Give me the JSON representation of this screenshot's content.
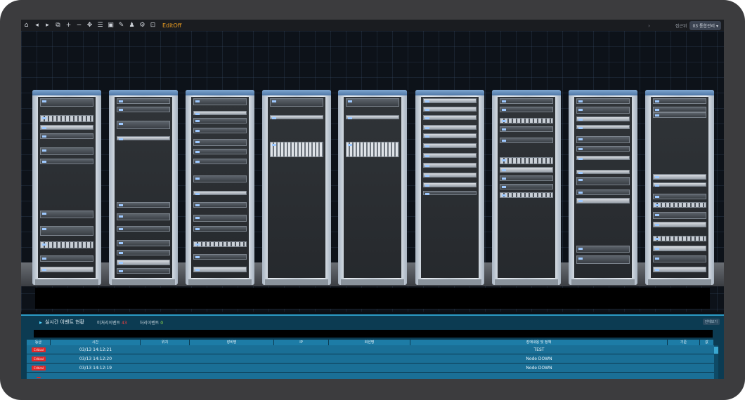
{
  "toolbar": {
    "icons": [
      "home-icon",
      "step-back-icon",
      "play-icon",
      "copy-icon",
      "add-icon",
      "remove-icon",
      "move-icon",
      "grid-icon",
      "image-icon",
      "user-add-icon",
      "user-icon",
      "user-settings-icon",
      "export-icon"
    ],
    "glyphs": [
      "⌂",
      "◂",
      "▸",
      "⧉",
      "+",
      "−",
      "✥",
      "☰",
      "▣",
      "✎",
      "♟",
      "⚙",
      "⊡"
    ],
    "edit_label": "EditOff",
    "layout_label": "접근위",
    "layout_value": "03 통합관리 ▾"
  },
  "event_panel": {
    "title": "실시간 이벤트 현황",
    "unresolved_label": "미처리이벤트",
    "unresolved_count": "43",
    "resolved_label": "처리이벤트",
    "resolved_count": "0",
    "button_label": "전체보기",
    "columns": [
      "등급",
      "시간",
      "위치",
      "장비명",
      "IP",
      "회선명",
      "장애내용 및 정책",
      "기준",
      "값"
    ],
    "rows": [
      {
        "level": "Critical",
        "time": "03/13 14:12:21",
        "location": "",
        "device": "",
        "ip": "",
        "line": "",
        "content": "TEST"
      },
      {
        "level": "Critical",
        "time": "03/13 14:12:20",
        "location": "",
        "device": "",
        "ip": "",
        "line": "",
        "content": "Node DOWN"
      },
      {
        "level": "Critical",
        "time": "03/13 14:12:19",
        "location": "",
        "device": "",
        "ip": "",
        "line": "",
        "content": "Node DOWN"
      }
    ]
  },
  "colors": {
    "accent": "#2c9bc6",
    "critical": "#e02828",
    "edit": "#f0a020"
  }
}
